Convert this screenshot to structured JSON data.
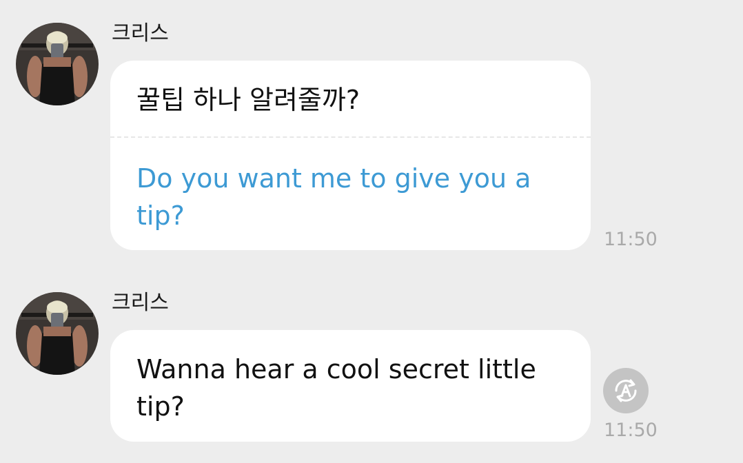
{
  "messages": [
    {
      "sender": "크리스",
      "text": "꿀팁 하나 알려줄까?",
      "translation": "Do you want me to give you a tip?",
      "time": "11:50"
    },
    {
      "sender": "크리스",
      "text": "Wanna hear a cool secret little tip?",
      "time": "11:50",
      "action_icon": "auto-translate-icon"
    }
  ],
  "colors": {
    "background": "#ededed",
    "bubble": "#ffffff",
    "translation_text": "#3d9ad4",
    "timestamp": "#a9a9a9"
  }
}
